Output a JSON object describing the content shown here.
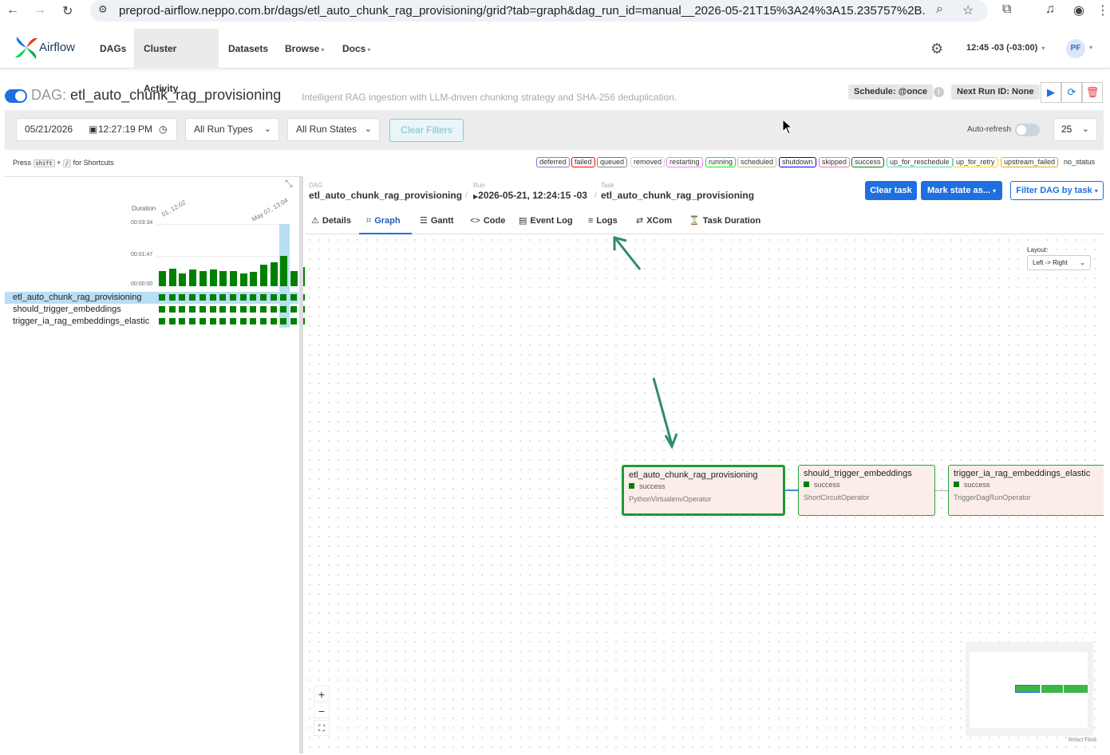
{
  "browser": {
    "url": "preprod-airflow.neppo.com.br/dags/etl_auto_chunk_rag_provisioning/grid?tab=graph&dag_run_id=manual__2026-05-21T15%3A24%3A15.235757%2B..."
  },
  "navbar": {
    "brand": "Airflow",
    "items": [
      {
        "label": "DAGs",
        "active": false,
        "dropdown": false
      },
      {
        "label": "Cluster Activity",
        "active": true,
        "dropdown": false
      },
      {
        "label": "Datasets",
        "active": false,
        "dropdown": false
      },
      {
        "label": "Browse",
        "active": false,
        "dropdown": true
      },
      {
        "label": "Docs",
        "active": false,
        "dropdown": true
      }
    ],
    "clock": "12:45 -03 (-03:00)",
    "user_initials": "PF"
  },
  "dag_header": {
    "prefix": "DAG:",
    "dag_id": "etl_auto_chunk_rag_provisioning",
    "description": "Intelligent RAG ingestion with LLM-driven chunking strategy and SHA-256 deduplication.",
    "schedule": "Schedule: @once",
    "next_run": "Next Run ID: None"
  },
  "filters": {
    "date": "05/21/2026",
    "time": "12:27:19 PM",
    "run_types": "All Run Types",
    "run_states": "All Run States",
    "clear_label": "Clear Filters",
    "auto_refresh_label": "Auto-refresh",
    "page_size": "25"
  },
  "shortcuts": {
    "press": "Press",
    "key1": "shift",
    "plus": "+",
    "key2": "/",
    "suffix": "for Shortcuts"
  },
  "legend": [
    {
      "label": "deferred",
      "color": "#9370db"
    },
    {
      "label": "failed",
      "color": "#ff0000"
    },
    {
      "label": "queued",
      "color": "#808080"
    },
    {
      "label": "removed",
      "color": "#d3d3d3"
    },
    {
      "label": "restarting",
      "color": "#ee82ee"
    },
    {
      "label": "running",
      "color": "#00ff00"
    },
    {
      "label": "scheduled",
      "color": "#d2b48c"
    },
    {
      "label": "shutdown",
      "color": "#0000ff"
    },
    {
      "label": "skipped",
      "color": "#ff69b4"
    },
    {
      "label": "success",
      "color": "#008000"
    },
    {
      "label": "up_for_reschedule",
      "color": "#40e0d0"
    },
    {
      "label": "up_for_retry",
      "color": "#ffd700"
    },
    {
      "label": "upstream_failed",
      "color": "#ffa500"
    },
    {
      "label": "no_status",
      "color": "#ffffff"
    }
  ],
  "grid": {
    "duration_label": "Duration",
    "ticks": [
      "00:03:34",
      "00:01:47",
      "00:00:00"
    ],
    "date_labels": [
      "01, 12:02",
      "May 07, 13:04"
    ],
    "run_durations_fraction": [
      0.24,
      0.28,
      0.2,
      0.26,
      0.24,
      0.26,
      0.24,
      0.24,
      0.2,
      0.22,
      0.34,
      0.38,
      0.48,
      0.24,
      0.3
    ],
    "tasks": [
      {
        "name": "etl_auto_chunk_rag_provisioning",
        "selected": true
      },
      {
        "name": "should_trigger_embeddings",
        "selected": false
      },
      {
        "name": "trigger_ia_rag_embeddings_elastic",
        "selected": false
      }
    ]
  },
  "detail": {
    "crumbs": [
      {
        "caption": "DAG",
        "value": "etl_auto_chunk_rag_provisioning"
      },
      {
        "caption": "Run",
        "value": "2026-05-21, 12:24:15 -03"
      },
      {
        "caption": "Task",
        "value": "etl_auto_chunk_rag_provisioning"
      }
    ],
    "clear_task": "Clear task",
    "mark_state": "Mark state as...",
    "filter_dag": "Filter DAG by task",
    "tabs": [
      {
        "icon": "⚠",
        "label": "Details"
      },
      {
        "icon": "⌗",
        "label": "Graph"
      },
      {
        "icon": "☰",
        "label": "Gantt"
      },
      {
        "icon": "<>",
        "label": "Code"
      },
      {
        "icon": "▤",
        "label": "Event Log"
      },
      {
        "icon": "≡",
        "label": "Logs"
      },
      {
        "icon": "⇄",
        "label": "XCom"
      },
      {
        "icon": "⌛",
        "label": "Task Duration"
      }
    ],
    "active_tab": "Graph"
  },
  "graph": {
    "layout_label": "Layout:",
    "layout_value": "Left -> Right",
    "nodes": [
      {
        "name": "etl_auto_chunk_rag_provisioning",
        "state": "success",
        "operator": "PythonVirtualenvOperator",
        "selected": true
      },
      {
        "name": "should_trigger_embeddings",
        "state": "success",
        "operator": "ShortCircuitOperator",
        "selected": false
      },
      {
        "name": "trigger_ia_rag_embeddings_elastic",
        "state": "success",
        "operator": "TriggerDagRunOperator",
        "selected": false
      }
    ],
    "zoom_in": "+",
    "zoom_out": "−",
    "fit": "⛶",
    "attribution": "React Flow"
  }
}
